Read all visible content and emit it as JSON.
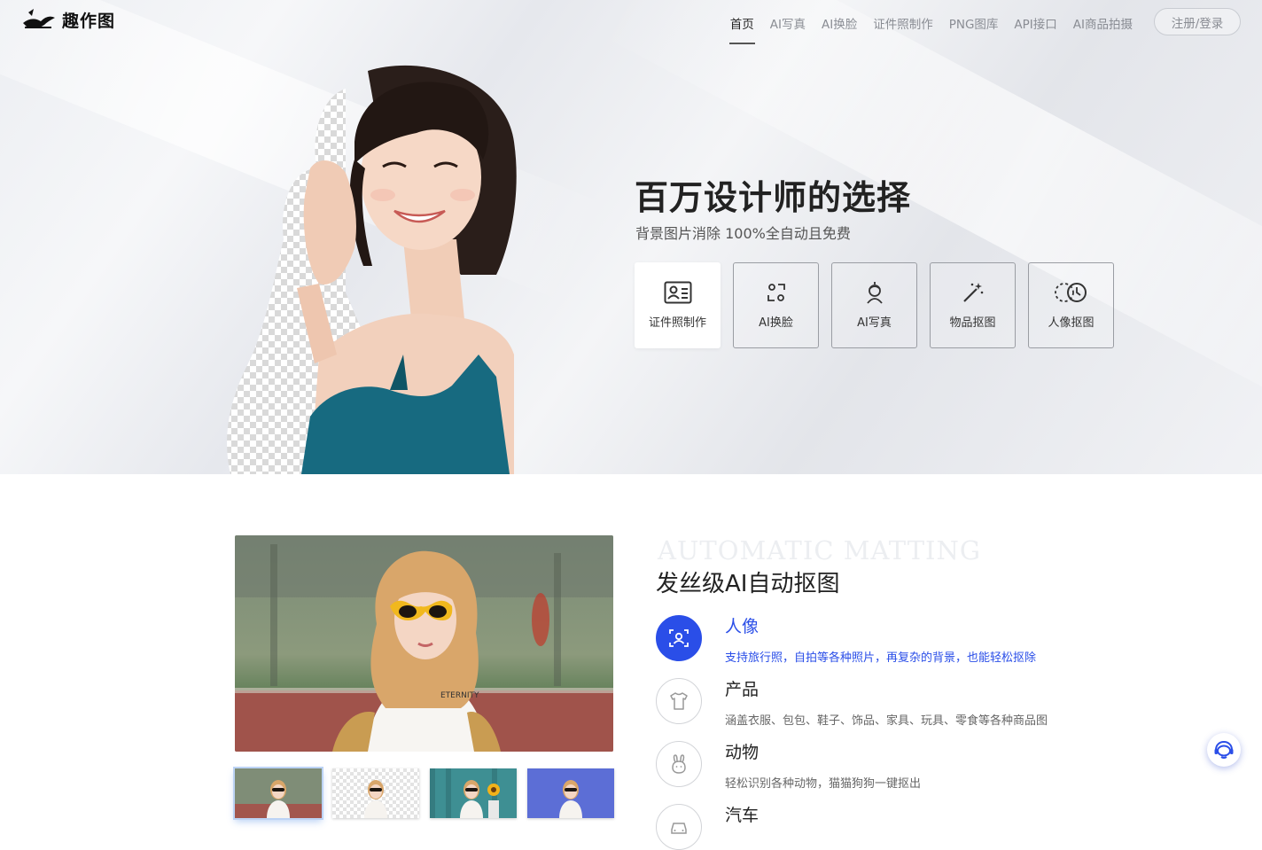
{
  "nav": {
    "logo_text": "趣作图",
    "links": [
      {
        "label": "首页"
      },
      {
        "label": "AI写真"
      },
      {
        "label": "AI换脸"
      },
      {
        "label": "证件照制作"
      },
      {
        "label": "PNG图库"
      },
      {
        "label": "API接口"
      },
      {
        "label": "AI商品拍摄"
      }
    ],
    "login_label": "注册/登录"
  },
  "hero": {
    "title": "百万设计师的选择",
    "subtitle": "背景图片消除 100%全自动且免费",
    "tools": [
      {
        "label": "证件照制作",
        "icon": "id-card-icon"
      },
      {
        "label": "AI换脸",
        "icon": "face-swap-icon"
      },
      {
        "label": "AI写真",
        "icon": "portrait-icon"
      },
      {
        "label": "物品抠图",
        "icon": "magic-wand-icon"
      },
      {
        "label": "人像抠图",
        "icon": "person-cutout-icon"
      }
    ]
  },
  "matting": {
    "watermark": "AUTOMATIC MATTING",
    "title": "发丝级AI自动抠图",
    "features": [
      {
        "name": "人像",
        "desc": "支持旅行照，自拍等各种照片，再复杂的背景，也能轻松抠除",
        "icon": "face-scan-icon"
      },
      {
        "name": "产品",
        "desc": "涵盖衣服、包包、鞋子、饰品、家具、玩具、零食等各种商品图",
        "icon": "tshirt-icon"
      },
      {
        "name": "动物",
        "desc": "轻松识别各种动物，猫猫狗狗一键抠出",
        "icon": "rabbit-icon"
      },
      {
        "name": "汽车",
        "desc": "",
        "icon": "car-icon"
      }
    ]
  },
  "colors": {
    "accent": "#2a4ee8",
    "text_dark": "#222222",
    "nav_muted": "#8a8d94"
  }
}
